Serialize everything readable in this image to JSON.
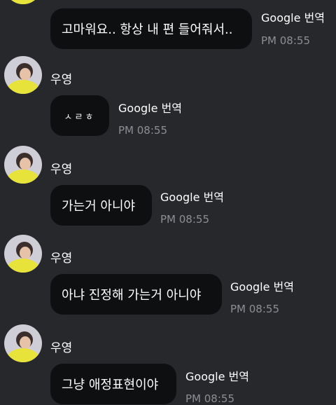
{
  "colors": {
    "background": "#27282c",
    "bubble": "#0e0f11",
    "text": "#ffffff",
    "timestamp": "#8d8e93",
    "avatar_shirt": "#e8e33a"
  },
  "messages": [
    {
      "sender": "",
      "text": "고마워요.. 항상 내 편 들어줘서..",
      "translate_label": "Google 번역",
      "time": "PM 08:55"
    },
    {
      "sender": "우영",
      "text": "ㅅㄹㅎ",
      "translate_label": "Google 번역",
      "time": "PM 08:55"
    },
    {
      "sender": "우영",
      "text": "가는거 아니야",
      "translate_label": "Google 번역",
      "time": "PM 08:55"
    },
    {
      "sender": "우영",
      "text": "아냐 진정해 가는거 아니야",
      "translate_label": "Google 번역",
      "time": "PM 08:55"
    },
    {
      "sender": "우영",
      "text": "그냥 애정표현이야",
      "translate_label": "Google 번역",
      "time": "PM 08:55"
    }
  ]
}
